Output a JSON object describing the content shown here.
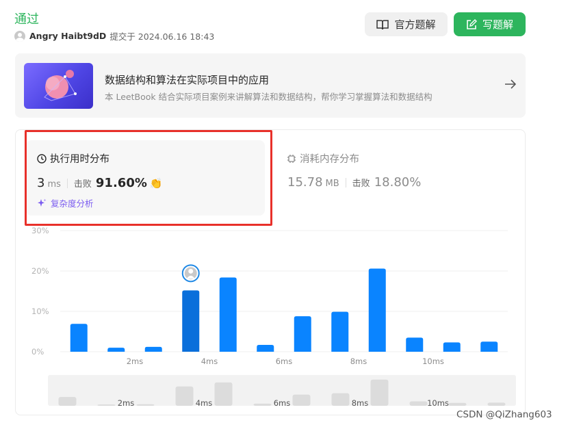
{
  "status": "通过",
  "submission": {
    "user": "Angry Haibt9dD",
    "submitted_at": "提交于 2024.06.16 18:43"
  },
  "buttons": {
    "official": "官方题解",
    "write": "写题解"
  },
  "banner": {
    "title": "数据结构和算法在实际项目中的应用",
    "subtitle": "本 LeetBook 结合实际项目案例来讲解算法和数据结构，帮你学习掌握算法和数据结构"
  },
  "runtime": {
    "title": "执行用时分布",
    "value": "3",
    "unit": "ms",
    "beat_label": "击败",
    "beat_pct": "91.60%",
    "complexity_link": "复杂度分析"
  },
  "memory": {
    "title": "消耗内存分布",
    "value": "15.78",
    "unit": "MB",
    "beat_label": "击败",
    "beat_pct": "18.80%"
  },
  "colors": {
    "accent_green": "#2db55d",
    "bar_blue": "#0a84ff",
    "bar_selected": "#0a6fdb",
    "highlight_red": "#e8302a"
  },
  "chart_data": {
    "type": "bar",
    "ylim": [
      0,
      30
    ],
    "y_ticks": [
      "0%",
      "10%",
      "20%",
      "30%"
    ],
    "x_ticks": [
      "2ms",
      "4ms",
      "6ms",
      "8ms",
      "10ms"
    ],
    "values": [
      6.9,
      1.0,
      1.2,
      15.2,
      18.4,
      1.7,
      8.8,
      9.9,
      20.6,
      3.5,
      2.3,
      2.5
    ],
    "selected_index": 3,
    "grid": true
  },
  "watermark": "CSDN @QiZhang603"
}
